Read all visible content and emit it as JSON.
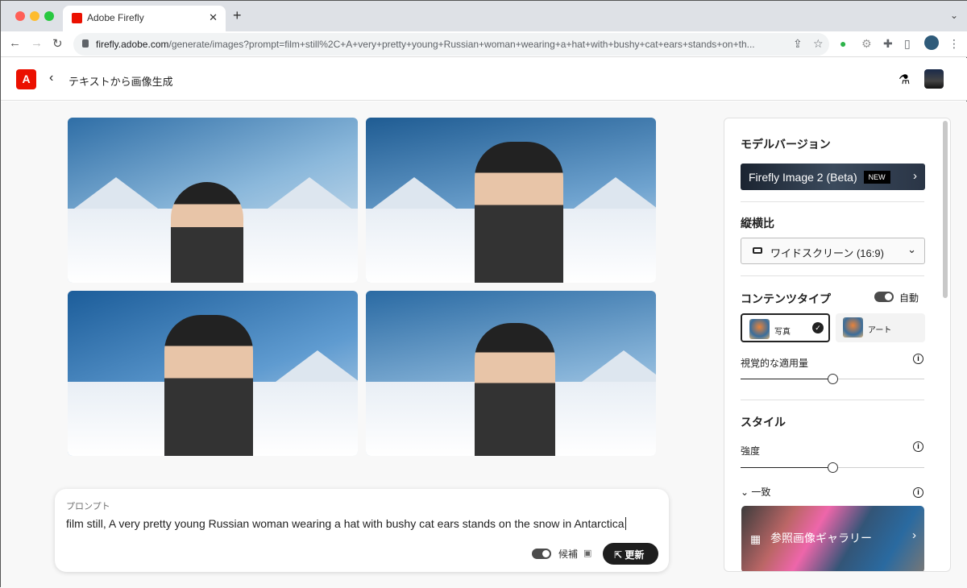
{
  "browser": {
    "tab_title": "Adobe Firefly",
    "url_host": "firefly.adobe.com",
    "url_path": "/generate/images?prompt=film+still%2C+A+very+pretty+young+Russian+woman+wearing+a+hat+with+bushy+cat+ears+stands+on+th..."
  },
  "app": {
    "logo": "A",
    "title": "テキストから画像生成"
  },
  "images": [
    {
      "label": "generated-image-1"
    },
    {
      "label": "generated-image-2"
    },
    {
      "label": "generated-image-3"
    },
    {
      "label": "generated-image-4"
    }
  ],
  "prompt": {
    "label": "プロンプト",
    "value": "film still, A very pretty young Russian woman wearing a hat with bushy cat ears stands on the snow in Antarctica",
    "suggestions_label": "候補",
    "suggestions_on": true,
    "update_label": "更新"
  },
  "panel": {
    "model_heading": "モデルバージョン",
    "model_name": "Firefly Image 2 (Beta)",
    "model_badge": "NEW",
    "aspect_heading": "縦横比",
    "aspect_value": "ワイドスクリーン (16:9)",
    "content_heading": "コンテンツタイプ",
    "auto_label": "自動",
    "auto_on": true,
    "content_types": [
      {
        "label": "写真",
        "selected": true
      },
      {
        "label": "アート",
        "selected": false
      }
    ],
    "visual_label": "視覚的な適用量",
    "visual_value": 0.5,
    "style_heading": "スタイル",
    "strength_label": "強度",
    "strength_value": 0.5,
    "match_label": "一致",
    "gallery_label": "参照画像ギャラリー"
  }
}
